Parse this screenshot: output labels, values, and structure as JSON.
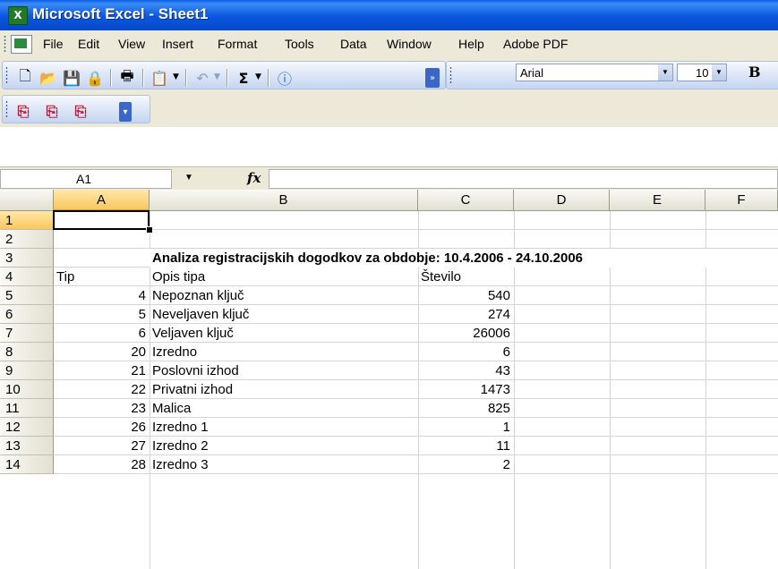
{
  "window": {
    "title": "Microsoft Excel - Sheet1"
  },
  "menu": [
    "File",
    "Edit",
    "View",
    "Insert",
    "Format",
    "Tools",
    "Data",
    "Window",
    "Help",
    "Adobe PDF"
  ],
  "toolbar": {
    "font_name": "Arial",
    "font_size": "10",
    "bold_label": "B"
  },
  "formula_bar": {
    "name_box": "A1",
    "fx_label": "fx",
    "formula": ""
  },
  "sheet": {
    "columns": [
      "A",
      "B",
      "C",
      "D",
      "E",
      "F"
    ],
    "rows": [
      "1",
      "2",
      "3",
      "4",
      "5",
      "6",
      "7",
      "8",
      "9",
      "10",
      "11",
      "12",
      "13",
      "14"
    ],
    "title": "Analiza registracijskih dogodkov za obdobje: 10.4.2006 - 24.10.2006",
    "headers": {
      "tip": "Tip",
      "opis": "Opis tipa",
      "stevilo": "Število"
    },
    "data": [
      {
        "tip": "4",
        "opis": "Nepoznan ključ",
        "stevilo": "540"
      },
      {
        "tip": "5",
        "opis": "Neveljaven ključ",
        "stevilo": "274"
      },
      {
        "tip": "6",
        "opis": "Veljaven ključ",
        "stevilo": "26006"
      },
      {
        "tip": "20",
        "opis": "Izredno",
        "stevilo": "6"
      },
      {
        "tip": "21",
        "opis": "Poslovni izhod",
        "stevilo": "43"
      },
      {
        "tip": "22",
        "opis": "Privatni izhod",
        "stevilo": "1473"
      },
      {
        "tip": "23",
        "opis": "Malica",
        "stevilo": "825"
      },
      {
        "tip": "26",
        "opis": "Izredno 1",
        "stevilo": "1"
      },
      {
        "tip": "27",
        "opis": "Izredno 2",
        "stevilo": "11"
      },
      {
        "tip": "28",
        "opis": "Izredno 3",
        "stevilo": "2"
      }
    ]
  },
  "icons": {
    "app": "excel-icon",
    "new": "new-document-icon",
    "open": "open-folder-icon",
    "save": "save-icon",
    "permission": "permission-icon",
    "print": "print-icon",
    "paste": "paste-icon",
    "undo": "undo-icon",
    "autosum": "autosum-icon",
    "help": "help-icon",
    "pdf": "pdf-icon"
  }
}
